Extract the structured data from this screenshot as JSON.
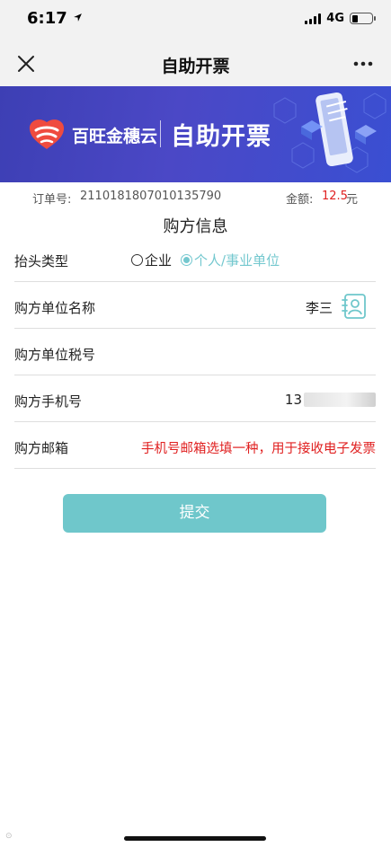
{
  "status_bar": {
    "time": "6:17",
    "network": "4G"
  },
  "nav": {
    "title": "自助开票",
    "close_icon": "close-icon",
    "more_icon": "more-icon"
  },
  "banner": {
    "brand": "百旺金穗云",
    "title": "自助开票",
    "colors": {
      "bg": "#4345c0",
      "logo_red": "#ef4b3f"
    }
  },
  "order": {
    "number_label": "订单号:",
    "number": "2110181807010135790",
    "amount_label": "金额:",
    "amount": "12.5",
    "amount_unit": "元"
  },
  "section_title": "购方信息",
  "form": {
    "header_type": {
      "label": "抬头类型",
      "options": [
        "企业",
        "个人/事业单位"
      ],
      "selected": "个人/事业单位"
    },
    "buyer_name": {
      "label": "购方单位名称",
      "value": "李三"
    },
    "tax_number": {
      "label": "购方单位税号",
      "value": ""
    },
    "phone": {
      "label": "购方手机号",
      "value_visible": "13"
    },
    "email": {
      "label": "购方邮箱",
      "hint": "手机号邮箱选填一种，用于接收电子发票"
    }
  },
  "submit_label": "提交",
  "accent_color": "#6fc7cb"
}
